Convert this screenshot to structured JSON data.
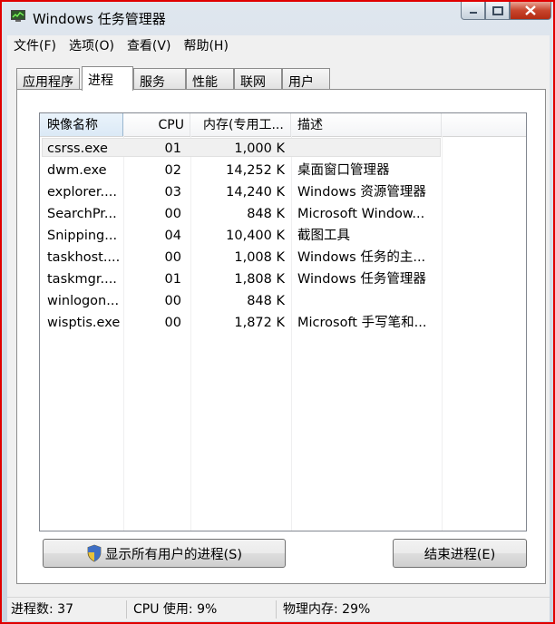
{
  "window": {
    "title": "Windows 任务管理器"
  },
  "menu": [
    "文件(F)",
    "选项(O)",
    "查看(V)",
    "帮助(H)"
  ],
  "tabs": [
    "应用程序",
    "进程",
    "服务",
    "性能",
    "联网",
    "用户"
  ],
  "active_tab": "进程",
  "columns": [
    "映像名称",
    "CPU",
    "内存(专用工...",
    "描述"
  ],
  "processes": [
    {
      "name": "csrss.exe",
      "cpu": "01",
      "mem": "1,000 K",
      "desc": ""
    },
    {
      "name": "dwm.exe",
      "cpu": "02",
      "mem": "14,252 K",
      "desc": "桌面窗口管理器"
    },
    {
      "name": "explorer....",
      "cpu": "03",
      "mem": "14,240 K",
      "desc": "Windows 资源管理器"
    },
    {
      "name": "SearchPr...",
      "cpu": "00",
      "mem": "848 K",
      "desc": "Microsoft Window..."
    },
    {
      "name": "Snipping...",
      "cpu": "04",
      "mem": "10,400 K",
      "desc": "截图工具"
    },
    {
      "name": "taskhost....",
      "cpu": "00",
      "mem": "1,008 K",
      "desc": "Windows 任务的主..."
    },
    {
      "name": "taskmgr....",
      "cpu": "01",
      "mem": "1,808 K",
      "desc": "Windows 任务管理器"
    },
    {
      "name": "winlogon...",
      "cpu": "00",
      "mem": "848 K",
      "desc": ""
    },
    {
      "name": "wisptis.exe",
      "cpu": "00",
      "mem": "1,872 K",
      "desc": "Microsoft 手写笔和..."
    }
  ],
  "buttons": {
    "show_all": "显示所有用户的进程(S)",
    "end_process": "结束进程(E)"
  },
  "status": {
    "processes": "进程数: 37",
    "cpu": "CPU 使用: 9%",
    "memory": "物理内存: 29%"
  },
  "colors": {
    "desktop_red": "#d40000",
    "frame": "#c9d4e0",
    "close_button": "#c8452d"
  },
  "icons": {
    "app": "task-manager-icon",
    "minimize": "minimize-icon",
    "maximize": "maximize-icon",
    "close": "close-icon",
    "shield": "uac-shield-icon"
  }
}
